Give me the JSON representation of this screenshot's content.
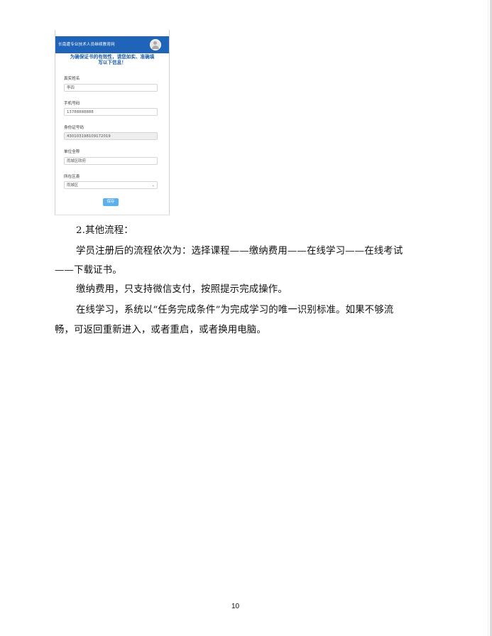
{
  "screenshot": {
    "header_title": "长南遭专业技术人员继续教育网",
    "notice_line1": "为确保证书的有效性，请您如实、准确填",
    "notice_line2": "写以下信息！",
    "fields": [
      {
        "label": "真实姓名",
        "value": "李四"
      },
      {
        "label": "手机号码",
        "value": "13788888888"
      },
      {
        "label": "身份证号码",
        "value": "430103198109172019"
      },
      {
        "label": "单位全称",
        "value": "雨城区政府"
      },
      {
        "label": "所在区县",
        "value": "雨城区"
      }
    ],
    "save_label": "保存"
  },
  "section_heading": "2.其他流程：",
  "paragraphs": {
    "p1_line1": "学员注册后的流程依次为：选择课程——缴纳费用——在线学习——在线考试",
    "p1_line2": "——下载证书。",
    "p2": "缴纳费用，只支持微信支付，按照提示完成操作。",
    "p3_line1": "在线学习，系统以“任务完成条件”为完成学习的唯一识别标准。如果不够流",
    "p3_line2": "畅，可返回重新进入，或者重启，或者换用电脑。"
  },
  "page_number": "10"
}
